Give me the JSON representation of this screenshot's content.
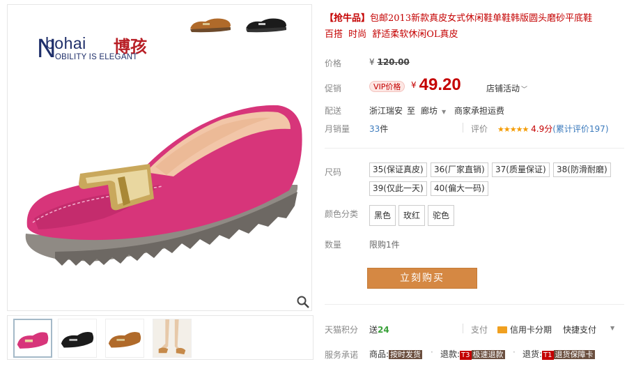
{
  "brand": {
    "name": "bohai",
    "name_cn": "博孩",
    "big_letter": "N",
    "slogan": "OBILITY IS ELEGANT"
  },
  "title": {
    "prefix": "【抢牛品】",
    "text": "包邮2013新款真皮女式休闲鞋单鞋韩版圆头磨砂平底鞋",
    "subtitle": "百搭  时尚  舒适柔软休闲OL真皮"
  },
  "price": {
    "label": "价格",
    "currency": "¥",
    "original": "120.00"
  },
  "promo": {
    "label": "促销",
    "vip_tag": "VIP价格",
    "currency": "¥",
    "value": "49.20",
    "shop_activity": "店铺活动"
  },
  "shipping": {
    "label": "配送",
    "from": "浙江瑞安",
    "to_word": "至",
    "to": "廊坊",
    "fee": "商家承担运费"
  },
  "sales": {
    "label": "月销量",
    "count": "33",
    "unit": "件",
    "rating_label": "评价",
    "stars": "★★★★★",
    "rating": "4.9分",
    "review_count": "(累计评价197)"
  },
  "size": {
    "label": "尺码",
    "options": [
      "35(保证真皮)",
      "36(厂家直销)",
      "37(质量保证)",
      "38(防滑耐磨)",
      "39(仅此一天)",
      "40(偏大一码)"
    ]
  },
  "color": {
    "label": "颜色分类",
    "options": [
      "黑色",
      "玫红",
      "驼色"
    ]
  },
  "quantity": {
    "label": "数量",
    "limit": "限购1件"
  },
  "buy_button": "立刻购买",
  "points": {
    "label": "天猫积分",
    "value": "送24",
    "value_num": "24",
    "value_prefix": "送",
    "pay_label": "支付",
    "credit": "信用卡分期",
    "quick_pay": "快捷支付"
  },
  "service": {
    "label": "服务承诺",
    "goods_label": "商品:",
    "goods_badge": "按时发货",
    "refund_label": "退款:",
    "refund_t": "T3",
    "refund_badge": "极速退款",
    "return_label": "退货:",
    "return_t": "T1",
    "return_badge": "退货保障卡"
  },
  "colors": {
    "accent_red": "#c40000",
    "buy_button": "#d58843",
    "shoe_pink": "#d7357a",
    "star": "#f49b00"
  }
}
